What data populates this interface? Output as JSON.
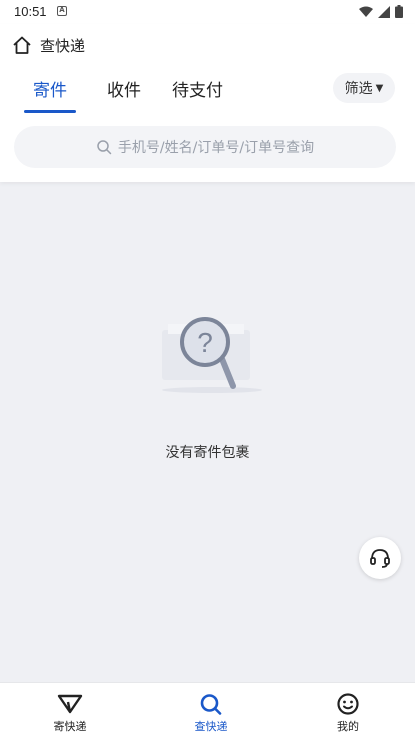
{
  "status_bar": {
    "time": "10:51",
    "notification_badge": "A"
  },
  "header": {
    "title": "查快递"
  },
  "tabs": [
    {
      "label": "寄件",
      "active": true
    },
    {
      "label": "收件",
      "active": false
    },
    {
      "label": "待支付",
      "active": false
    }
  ],
  "filter": {
    "label": "筛选"
  },
  "search": {
    "placeholder": "手机号/姓名/订单号/订单号查询"
  },
  "empty_state": {
    "message": "没有寄件包裹"
  },
  "bottom_nav": [
    {
      "label": "寄快递",
      "icon": "send-icon",
      "active": false
    },
    {
      "label": "查快递",
      "icon": "search-icon",
      "active": true
    },
    {
      "label": "我的",
      "icon": "smiley-icon",
      "active": false
    }
  ],
  "colors": {
    "accent": "#1a58c9",
    "background": "#eff0f4",
    "surface": "#ffffff"
  }
}
